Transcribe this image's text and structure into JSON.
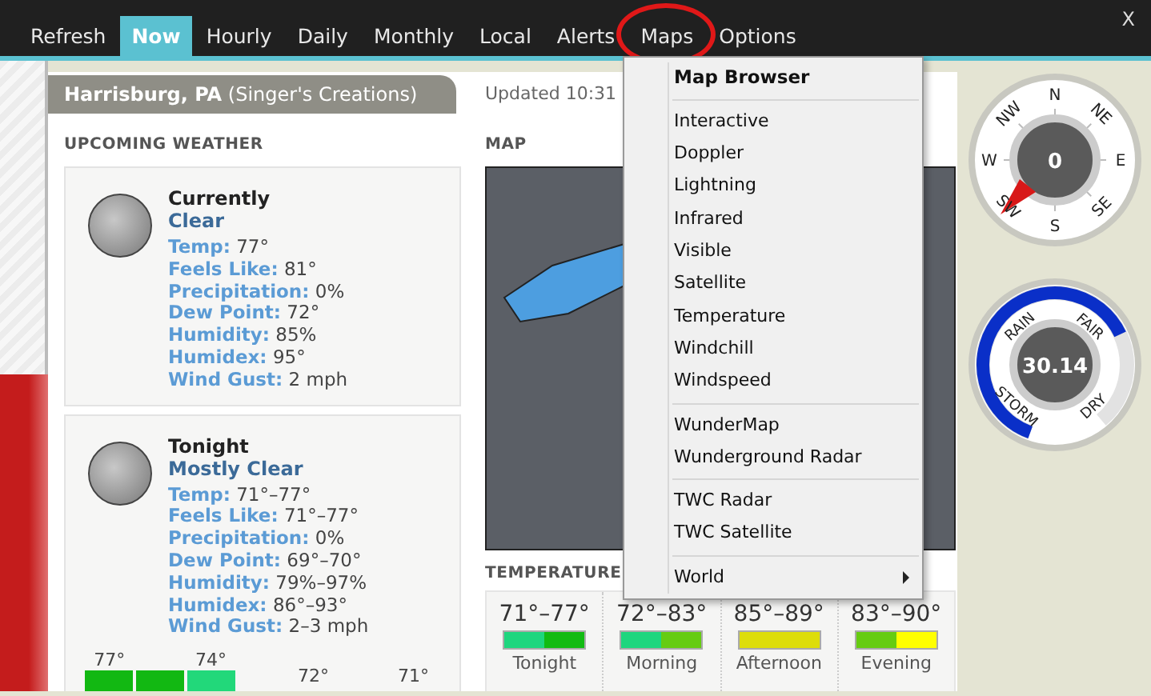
{
  "window": {
    "close": "X"
  },
  "tabs": [
    {
      "label": "Refresh",
      "selected": false,
      "highlighted": false
    },
    {
      "label": "Now",
      "selected": true,
      "highlighted": false
    },
    {
      "label": "Hourly",
      "selected": false,
      "highlighted": false
    },
    {
      "label": "Daily",
      "selected": false,
      "highlighted": false
    },
    {
      "label": "Monthly",
      "selected": false,
      "highlighted": false
    },
    {
      "label": "Local",
      "selected": false,
      "highlighted": false
    },
    {
      "label": "Alerts",
      "selected": false,
      "highlighted": false
    },
    {
      "label": "Maps",
      "selected": false,
      "highlighted": true
    },
    {
      "label": "Options",
      "selected": false,
      "highlighted": false
    }
  ],
  "location": "**Harrisburg, PA** (Singer's Creations)",
  "updated": "Updated 10:31",
  "upcoming": {
    "heading": "UPCOMING WEATHER",
    "periods": [
      {
        "title": "Currently",
        "condition": "Clear",
        "details": [
          {
            "label": "Temp:",
            "value": "77°"
          },
          {
            "label": "Feels Like:",
            "value": "81°"
          },
          {
            "label": "Precipitation:",
            "value": "0%"
          },
          {
            "label": "Dew Point:",
            "value": "72°"
          },
          {
            "label": "Humidity:",
            "value": "85%"
          },
          {
            "label": "Humidex:",
            "value": "95°"
          },
          {
            "label": "Wind Gust:",
            "value": "2 mph"
          }
        ]
      },
      {
        "title": "Tonight",
        "condition": "Mostly Clear",
        "details": [
          {
            "label": "Temp:",
            "value": "71°–77°"
          },
          {
            "label": "Feels Like:",
            "value": "71°–77°"
          },
          {
            "label": "Precipitation:",
            "value": "0%"
          },
          {
            "label": "Dew Point:",
            "value": "69°–70°"
          },
          {
            "label": "Humidity:",
            "value": "79%–97%"
          },
          {
            "label": "Humidex:",
            "value": "86°–93°"
          },
          {
            "label": "Wind Gust:",
            "value": "2–3 mph"
          }
        ]
      }
    ],
    "bars": [
      {
        "label": "77°",
        "color": "#12b812"
      },
      {
        "color": "#12b812"
      },
      {
        "label": "74°",
        "color": "#22d87a"
      },
      {
        "label": "72°"
      },
      {
        "label": "71°"
      }
    ]
  },
  "map": {
    "heading": "MAP"
  },
  "temperature": {
    "heading": "TEMPERATURE",
    "periods": [
      {
        "range": "71°–77°",
        "label": "Tonight",
        "segments": [
          {
            "color": "#1ed67e"
          },
          {
            "color": "#12bb12"
          }
        ]
      },
      {
        "range": "72°–83°",
        "label": "Morning",
        "segments": [
          {
            "color": "#1ed67e"
          },
          {
            "color": "#66cc11"
          }
        ]
      },
      {
        "range": "85°–89°",
        "label": "Afternoon",
        "segments": [
          {
            "color": "#dddd0a"
          }
        ]
      },
      {
        "range": "83°–90°",
        "label": "Evening",
        "segments": [
          {
            "color": "#66cc11"
          },
          {
            "color": "#ffff00"
          }
        ]
      }
    ]
  },
  "compass": {
    "reading": "0",
    "labels": [
      "N",
      "NE",
      "E",
      "SE",
      "S",
      "SW",
      "W",
      "NW"
    ]
  },
  "barometer": {
    "reading": "30.14",
    "labels": [
      "RAIN",
      "FAIR",
      "STORM",
      "DRY"
    ]
  },
  "menu": {
    "items": [
      {
        "kind": "header",
        "label": "Map Browser"
      },
      {
        "kind": "divider"
      },
      {
        "kind": "item",
        "label": "Interactive"
      },
      {
        "kind": "item",
        "label": "Doppler"
      },
      {
        "kind": "item",
        "label": "Lightning"
      },
      {
        "kind": "item",
        "label": "Infrared"
      },
      {
        "kind": "item",
        "label": "Visible"
      },
      {
        "kind": "item",
        "label": "Satellite"
      },
      {
        "kind": "item",
        "label": "Temperature"
      },
      {
        "kind": "item",
        "label": "Windchill"
      },
      {
        "kind": "item",
        "label": "Windspeed"
      },
      {
        "kind": "divider"
      },
      {
        "kind": "item",
        "label": "WunderMap"
      },
      {
        "kind": "item",
        "label": "Wunderground Radar"
      },
      {
        "kind": "divider"
      },
      {
        "kind": "item",
        "label": "TWC Radar"
      },
      {
        "kind": "item",
        "label": "TWC Satellite"
      },
      {
        "kind": "divider"
      },
      {
        "kind": "submenu",
        "label": "World"
      }
    ]
  }
}
